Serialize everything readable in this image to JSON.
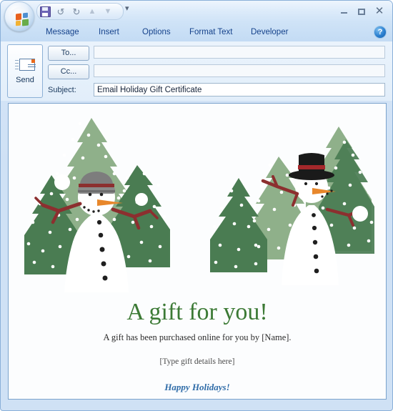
{
  "window": {
    "controls": {
      "minimize": "–",
      "maximize": "□",
      "close": "✕"
    }
  },
  "quick_access": {
    "items": [
      {
        "name": "save-icon",
        "label": "Save"
      },
      {
        "name": "undo-icon",
        "label": "↺"
      },
      {
        "name": "redo-icon",
        "label": "↻"
      },
      {
        "name": "previous-item-icon",
        "label": "▲"
      },
      {
        "name": "next-item-icon",
        "label": "▼"
      }
    ],
    "dropdown_glyph": "▾"
  },
  "ribbon": {
    "tabs": [
      {
        "label": "Message"
      },
      {
        "label": "Insert"
      },
      {
        "label": "Options"
      },
      {
        "label": "Format Text"
      },
      {
        "label": "Developer"
      }
    ],
    "help_glyph": "?"
  },
  "compose": {
    "send_label": "Send",
    "to_label": "To...",
    "cc_label": "Cc...",
    "subject_label": "Subject:",
    "to_value": "",
    "cc_value": "",
    "subject_value": "Email Holiday Gift Certificate"
  },
  "message_body": {
    "title": "A gift for you!",
    "subtitle": "A gift has been purchased online for you by [Name].",
    "details_placeholder": "[Type gift details here]",
    "closing": "Happy Holidays!"
  },
  "colors": {
    "title_green": "#3c7a35",
    "closing_blue": "#2f6ca8",
    "tree_dark": "#4a7c52",
    "tree_light": "#8fb08a",
    "tree_mid": "#6f9a6d",
    "carrot": "#e8872b",
    "branch": "#8c2f2f",
    "hat_gray": "#7d7d7d",
    "hat_black": "#1a1a1a",
    "hat_red": "#a5282b",
    "snow": "#ffffff",
    "coal": "#1f1f1f",
    "chrome_blue": "#cfe3f7",
    "tab_text": "#15428b"
  }
}
